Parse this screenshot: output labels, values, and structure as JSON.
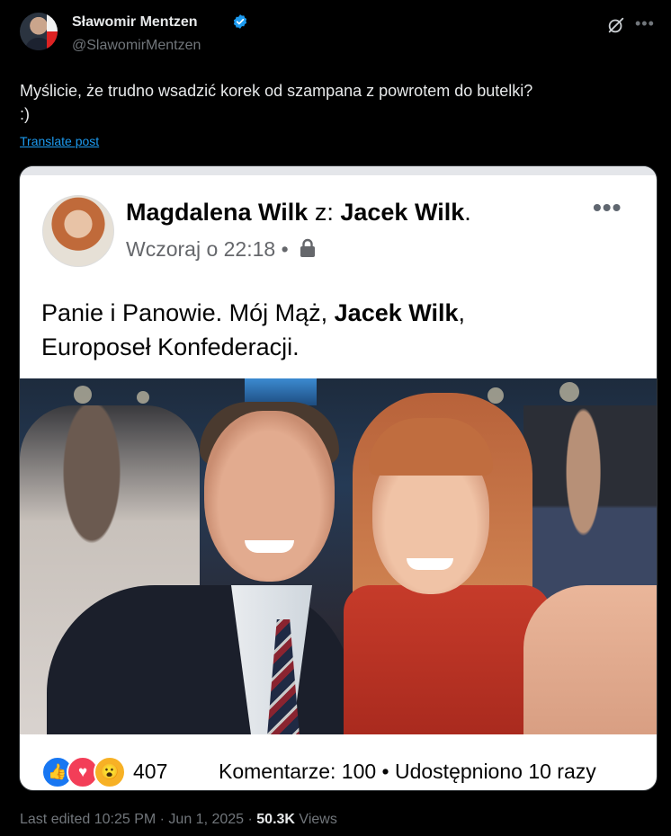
{
  "author": {
    "name": "Sławomir Mentzen",
    "handle": "@SlawomirMentzen"
  },
  "post": {
    "text": "Myślicie, że trudno wsadzić korek od szampana z powrotem do butelki?\n:)",
    "translate_label": "Translate post"
  },
  "embedded": {
    "author_name": "Magdalena Wilk",
    "with_prefix": "z:",
    "with_name": "Jacek Wilk",
    "with_suffix": ".",
    "timestamp": "Wczoraj o 22:18",
    "separator": "•",
    "text_before": "Panie i Panowie. Mój Mąż, ",
    "text_bold": "Jacek Wilk",
    "text_after": ",\nEuroposeł Konfederacji.",
    "reaction_count": "407",
    "stats": "Komentarze: 100 • Udostępniono 10 razy",
    "reactions": [
      "like-icon",
      "love-icon",
      "wow-icon"
    ]
  },
  "footer": {
    "edited": "Last edited 10:25 PM · Jun 1, 2025 · ",
    "views_count": "50.3K",
    "views_label": " Views"
  },
  "colors": {
    "background": "#000000",
    "accent": "#1d9bf0",
    "muted": "#71767b",
    "fb_like": "#1877f2"
  }
}
